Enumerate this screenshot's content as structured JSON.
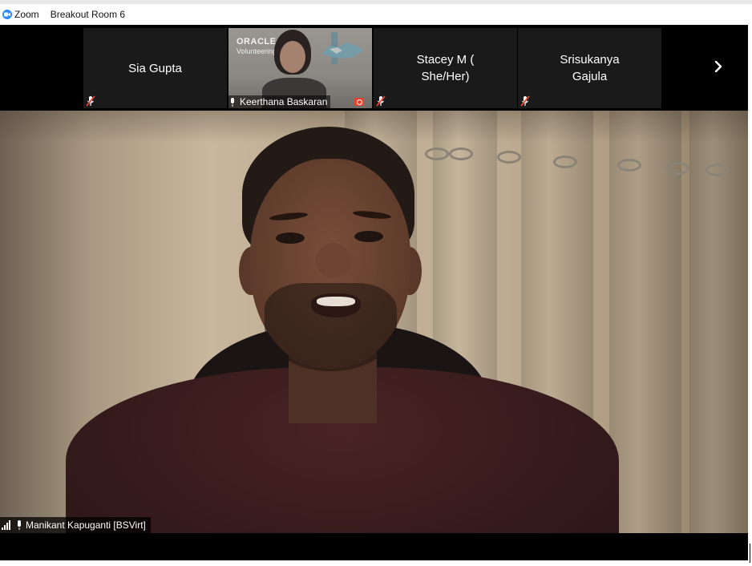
{
  "titlebar": {
    "app_name": "Zoom",
    "room_name": "Breakout Room 6"
  },
  "gallery": {
    "participants": [
      {
        "name": "Sia Gupta",
        "audio": "muted",
        "video": "off"
      },
      {
        "name": "Keerthana Baskaran",
        "audio": "on",
        "video": "on",
        "recording": true,
        "slide": {
          "logo": "ORACLE",
          "subtitle": "Volunteering"
        }
      },
      {
        "name": "Stacey M ( She/Her)",
        "audio": "muted",
        "video": "off"
      },
      {
        "name": "Srisukanya Gajula",
        "audio": "muted",
        "video": "off"
      }
    ],
    "next_page_icon": "chevron-right-icon"
  },
  "active_speaker": {
    "name": "Manikant Kapuganti [BSVirt]",
    "audio": "on",
    "signal_icon": "signal-bars-icon"
  },
  "colors": {
    "zoom_blue": "#2d8cff",
    "muted_red": "#e8422f",
    "strip_bg": "#000000",
    "tile_bg": "#1a1a1a"
  }
}
